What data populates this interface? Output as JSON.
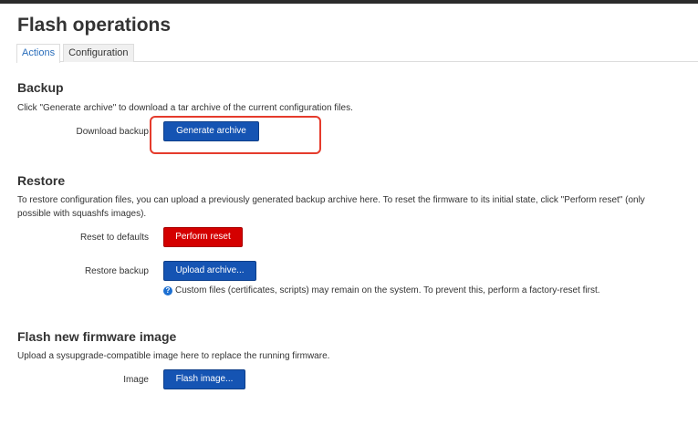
{
  "page": {
    "title": "Flash operations"
  },
  "tabs": [
    {
      "label": "Actions",
      "active": true
    },
    {
      "label": "Configuration",
      "active": false
    }
  ],
  "backup": {
    "title": "Backup",
    "description": "Click \"Generate archive\" to download a tar archive of the current configuration files.",
    "download_label": "Download backup",
    "generate_button": "Generate archive"
  },
  "restore": {
    "title": "Restore",
    "description": "To restore configuration files, you can upload a previously generated backup archive here. To reset the firmware to its initial state, click \"Perform reset\" (only possible with squashfs images).",
    "reset_label": "Reset to defaults",
    "reset_button": "Perform reset",
    "restore_label": "Restore backup",
    "upload_button": "Upload archive...",
    "hint_icon": "?",
    "hint": "Custom files (certificates, scripts) may remain on the system. To prevent this, perform a factory-reset first."
  },
  "flash": {
    "title": "Flash new firmware image",
    "description": "Upload a sysupgrade-compatible image here to replace the running firmware.",
    "image_label": "Image",
    "flash_button": "Flash image..."
  },
  "colors": {
    "primary_button": "#1554b3",
    "danger_button": "#d40000",
    "active_tab_text": "#2a6ebb",
    "highlight_annotation": "#e53b2c",
    "hint_icon": "#1c6fd1"
  },
  "icons": {
    "hint": "question-circle-icon"
  }
}
